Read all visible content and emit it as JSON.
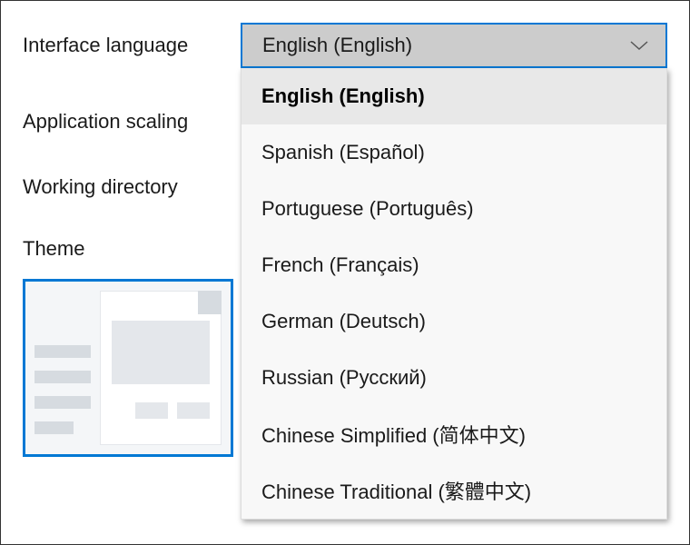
{
  "labels": {
    "interface_language": "Interface language",
    "application_scaling": "Application scaling",
    "working_directory": "Working directory",
    "theme": "Theme"
  },
  "language_dropdown": {
    "selected": "English (English)",
    "options": [
      "English (English)",
      "Spanish (Español)",
      "Portuguese (Português)",
      "French (Français)",
      "German (Deutsch)",
      "Russian (Русский)",
      "Chinese Simplified (简体中文)",
      "Chinese Traditional (繁體中文)"
    ]
  }
}
